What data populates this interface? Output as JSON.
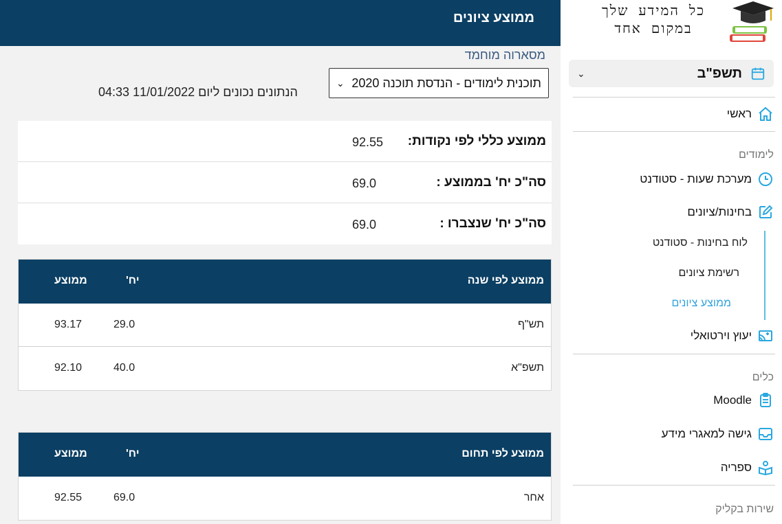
{
  "logo": {
    "line1": "כל המידע שלך",
    "line2": "במקום אחד"
  },
  "sidebar": {
    "year": "תשפ\"ב",
    "home": "ראשי",
    "section_studies": "לימודים",
    "schedule": "מערכת שעות - סטודנט",
    "exams": "בחינות/ציונים",
    "sub_exam_board": "לוח בחינות - סטודנט",
    "sub_grades_list": "רשימת ציונים",
    "sub_grade_average": "ממוצע ציונים",
    "virtual_advice": "יעוץ וירטואלי",
    "section_tools": "כלים",
    "moodle": "Moodle",
    "databases": "גישה למאגרי מידע",
    "library": "ספריה",
    "section_service": "שירות בקליק"
  },
  "header": {
    "title": "ממוצע ציונים"
  },
  "student": {
    "name": "מסארוה מוחמד"
  },
  "program": {
    "selected": "תוכנית לימודים - הנדסת תוכנה 2020"
  },
  "data_note": "הנתונים נכונים ליום 11/01/2022 04:33",
  "summary": {
    "avg_label": "ממוצע כללי לפי נקודות:",
    "avg_value": "92.55",
    "units_in_avg_label": "סה\"כ יח' בממוצע :",
    "units_in_avg_value": "69.0",
    "units_earned_label": "סה\"כ יח' שנצברו :",
    "units_earned_value": "69.0"
  },
  "by_year": {
    "headers": {
      "name": "ממוצע לפי שנה",
      "units": "יח'",
      "avg": "ממוצע"
    },
    "rows": [
      {
        "name": "תש\"ף",
        "units": "29.0",
        "avg": "93.17"
      },
      {
        "name": "תשפ\"א",
        "units": "40.0",
        "avg": "92.10"
      }
    ]
  },
  "by_field": {
    "headers": {
      "name": "ממוצע לפי תחום",
      "units": "יח'",
      "avg": "ממוצע"
    },
    "rows": [
      {
        "name": "אחר",
        "units": "69.0",
        "avg": "92.55"
      }
    ]
  },
  "colors": {
    "header_bg": "#0b3f63",
    "accent": "#33a3dc",
    "icon": "#29a8e0"
  },
  "icons": [
    "calendar-icon",
    "home-icon",
    "clock-icon",
    "edit-icon",
    "cast-icon",
    "clipboard-icon",
    "inbox-icon",
    "reader-icon",
    "chevron-down-icon",
    "graduation-cap-icon"
  ]
}
